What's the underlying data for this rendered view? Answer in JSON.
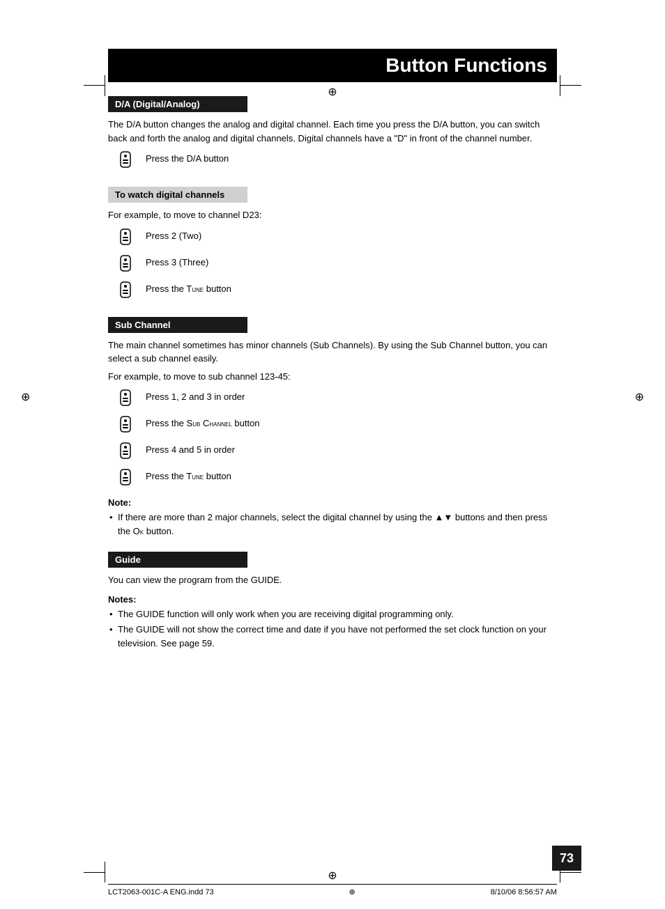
{
  "page": {
    "title": "Button Functions",
    "page_number": "73",
    "footer_left": "LCT2063-001C-A ENG.indd  73",
    "footer_right": "8/10/06  8:56:57 AM"
  },
  "sections": {
    "da": {
      "header": "D/A (Digital/Analog)",
      "description": "The D/A button changes the analog and digital channel.  Each time you press the D/A button, you can switch back and forth the analog and digital channels.  Digital channels have a \"D\" in front of the channel number.",
      "icon_action": "Press the D/A button"
    },
    "watch_digital": {
      "header": "To watch digital channels",
      "example_label": "For example, to move to channel D23:",
      "steps": [
        "Press 2 (Two)",
        "Press 3 (Three)",
        "Press the Tune button"
      ]
    },
    "sub_channel": {
      "header": "Sub Channel",
      "description": "The main channel sometimes has minor channels (Sub Channels).  By using the Sub Channel button, you can select a sub channel easily.",
      "example_label": "For example, to move to sub channel 123-45:",
      "steps": [
        "Press 1, 2 and 3 in order",
        "Press the Sub Channel button",
        "Press 4 and 5 in order",
        "Press the Tune button"
      ],
      "note_label": "Note:",
      "notes": [
        "If there are more than 2 major channels, select the digital channel by using the ▲▼ buttons and then press the Ok button."
      ]
    },
    "guide": {
      "header": "Guide",
      "description": "You can view the program from the GUIDE.",
      "notes_label": "Notes:",
      "notes": [
        "The GUIDE function will only work when you are receiving digital programming only.",
        "The GUIDE will not show the correct time and date if you have not performed the set clock function on your television.  See page 59."
      ]
    }
  }
}
